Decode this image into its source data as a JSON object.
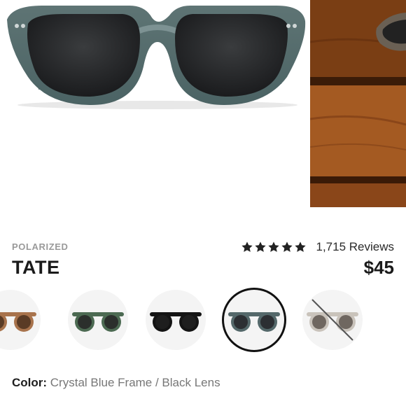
{
  "product": {
    "badge": "POLARIZED",
    "name": "TATE",
    "price": "$45",
    "reviews_text": "1,715 Reviews",
    "rating": 5
  },
  "swatches": [
    {
      "name": "Brown Frame",
      "frame": "#a8734c",
      "lens": "#5a3b25",
      "selected": false,
      "available": true
    },
    {
      "name": "Green Frame",
      "frame": "#4c6a52",
      "lens": "#2b2f2c",
      "selected": false,
      "available": true
    },
    {
      "name": "Black Frame",
      "frame": "#141414",
      "lens": "#1e1e1e",
      "selected": false,
      "available": true
    },
    {
      "name": "Crystal Blue Frame",
      "frame": "#54686a",
      "lens": "#2c2f33",
      "selected": true,
      "available": true
    },
    {
      "name": "Tortoise Frame",
      "frame": "#c9c3bb",
      "lens": "#6f6760",
      "selected": false,
      "available": false
    }
  ],
  "selection": {
    "label": "Color:",
    "value": "Crystal Blue Frame / Black Lens"
  },
  "colors": {
    "accent": "#111111",
    "muted": "#9a9a9a"
  },
  "icons": {
    "star": "star-icon"
  }
}
